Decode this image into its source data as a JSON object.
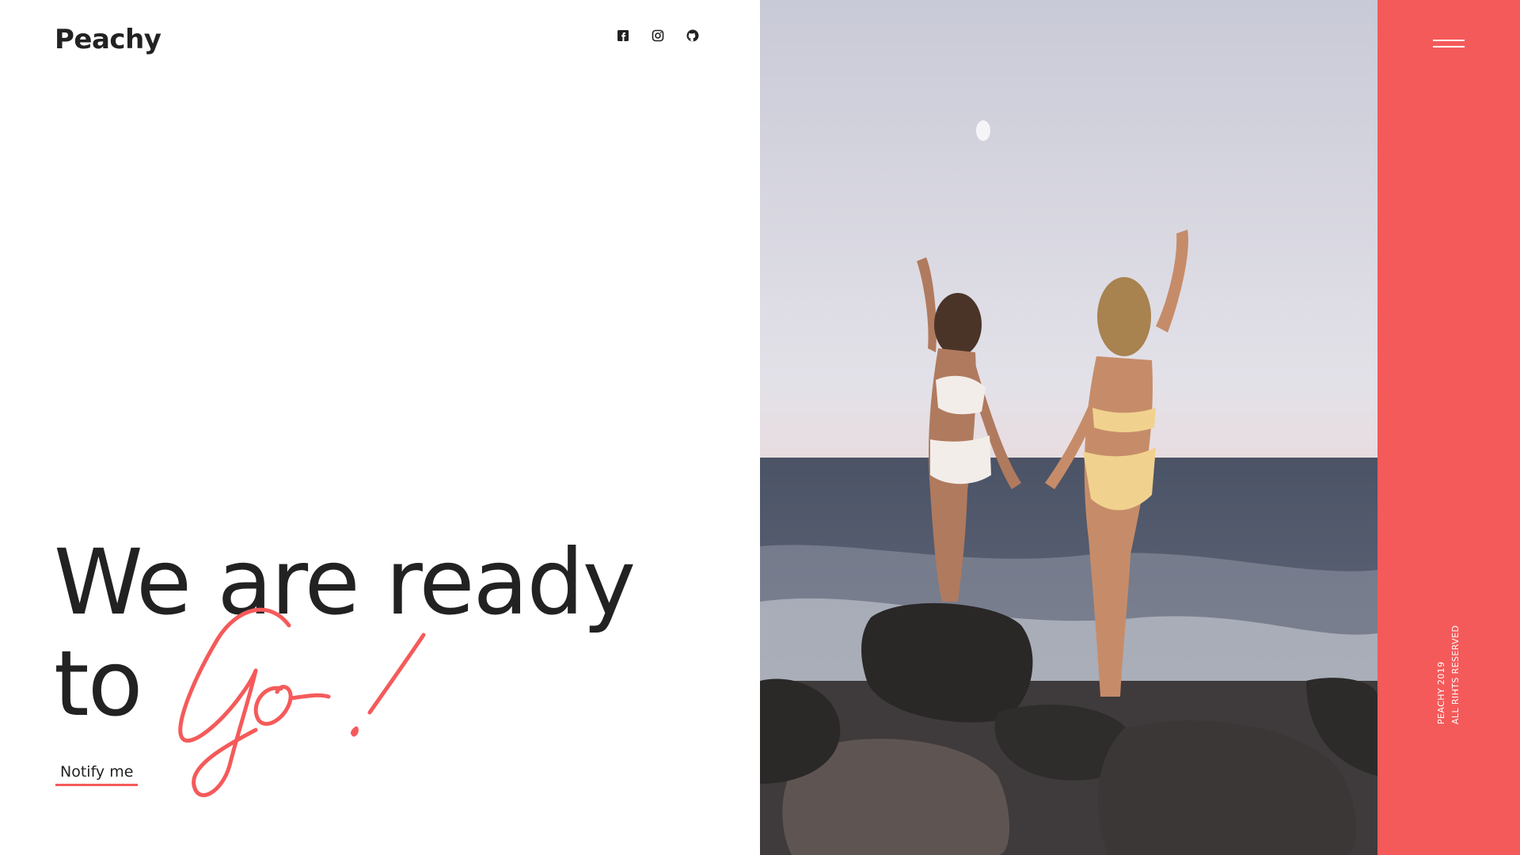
{
  "brand": {
    "name": "Peachy"
  },
  "social": {
    "facebook_icon": "facebook-icon",
    "instagram_icon": "instagram-icon",
    "github_icon": "github-icon"
  },
  "hero": {
    "line1": "We are ready",
    "line2": "to",
    "script_word": "Go!",
    "cta_label": "Notify me"
  },
  "sidebar": {
    "menu_icon": "hamburger-menu-icon",
    "copyright": "PEACHY 2019",
    "rights": "ALL RIHTS RESERVED"
  },
  "colors": {
    "accent": "#f55a5a",
    "text": "#222222",
    "background": "#ffffff"
  }
}
